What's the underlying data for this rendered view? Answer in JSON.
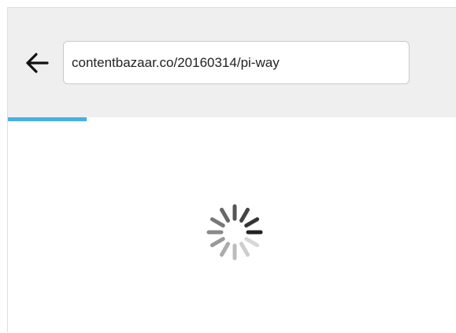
{
  "browser": {
    "back_icon": "left-arrow-icon",
    "address_bar": {
      "value": "contentbazaar.co/20160314/pi-way"
    },
    "progress": {
      "fraction": 0.175,
      "color": "#48b0e4"
    }
  },
  "page": {
    "loading_icon": "spinner-icon"
  }
}
